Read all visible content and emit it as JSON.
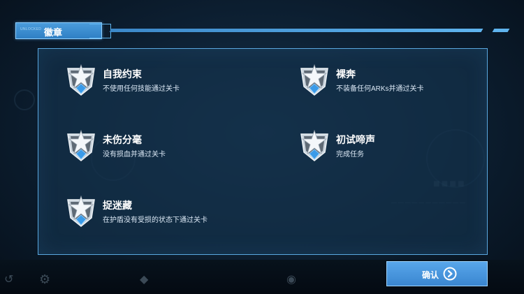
{
  "header": {
    "tag": "UNLOCKED",
    "title": "徽章"
  },
  "badges": [
    {
      "name": "自我约束",
      "desc": "不使用任何技能通过关卡",
      "icon": "star-shield-badge-icon"
    },
    {
      "name": "裸奔",
      "desc": "不装备任何ARKs并通过关卡",
      "icon": "star-shield-badge-icon"
    },
    {
      "name": "未伤分毫",
      "desc": "没有损血并通过关卡",
      "icon": "star-shield-badge-icon"
    },
    {
      "name": "初试啼声",
      "desc": "完成任务",
      "icon": "star-shield-badge-icon"
    },
    {
      "name": "捉迷藏",
      "desc": "在护盾没有受损的状态下通过关卡",
      "icon": "star-shield-badge-icon"
    }
  ],
  "confirm": {
    "label": "确认",
    "icon": "arrow-right-circle-icon"
  },
  "colors": {
    "accent": "#4a9cdc",
    "panel_border": "#5aa8e0",
    "badge_gem": "#3a9ae8"
  }
}
